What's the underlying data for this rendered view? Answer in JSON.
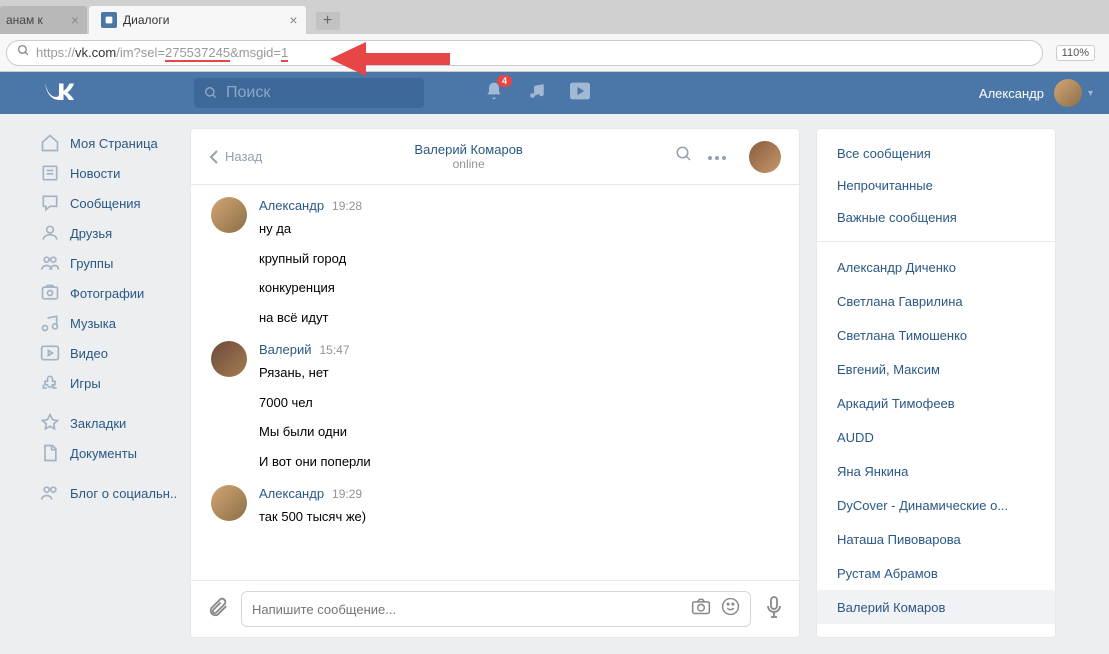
{
  "browser": {
    "tab1_partial": "анам к",
    "tab2_title": "Диалоги",
    "url_scheme": "https://",
    "url_host": "vk.com",
    "url_path": "/im?sel=",
    "url_sel": "275537245",
    "url_amp": "&msgid=",
    "url_msgid": "1",
    "zoom": "110%"
  },
  "header": {
    "search_placeholder": "Поиск",
    "notif_badge": "4",
    "user_name": "Александр"
  },
  "nav": {
    "items": [
      "Моя Страница",
      "Новости",
      "Сообщения",
      "Друзья",
      "Группы",
      "Фотографии",
      "Музыка",
      "Видео",
      "Игры"
    ],
    "items2": [
      "Закладки",
      "Документы"
    ],
    "items3": [
      "Блог о социальн.."
    ]
  },
  "chat": {
    "back": "Назад",
    "contact_name": "Валерий Комаров",
    "contact_status": "online",
    "messages": [
      {
        "author": "Александр",
        "time": "19:28",
        "lines": [
          "ну да",
          "крупный город",
          "конкуренция",
          "на всё идут"
        ]
      },
      {
        "author": "Валерий",
        "time": "15:47",
        "lines": [
          "Рязань, нет",
          "7000 чел",
          "Мы были одни",
          "И вот они поперли"
        ]
      },
      {
        "author": "Александр",
        "time": "19:29",
        "lines": [
          "так 500 тысяч же)"
        ]
      }
    ],
    "input_placeholder": "Напишите сообщение..."
  },
  "right": {
    "filters": [
      "Все сообщения",
      "Непрочитанные",
      "Важные сообщения"
    ],
    "dialogs": [
      "Александр Диченко",
      "Светлана Гаврилина",
      "Светлана Тимошенко",
      "Евгений, Максим",
      "Аркадий Тимофеев",
      "AUDD",
      "Яна Янкина",
      "DyCover - Динамические о...",
      "Наташа Пивоварова",
      "Рустам Абрамов",
      "Валерий Комаров"
    ],
    "active_idx": 10
  }
}
